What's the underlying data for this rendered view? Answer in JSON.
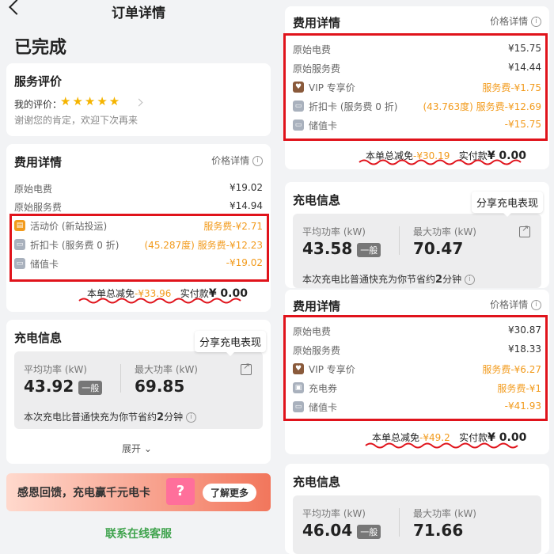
{
  "left": {
    "nav": {
      "title": "订单详情"
    },
    "status": "已完成",
    "review": {
      "title": "服务评价",
      "my_rating_label": "我的评价：",
      "stars": "★★★★★",
      "thanks": "谢谢您的肯定，欢迎下次再来"
    },
    "fees": {
      "title": "费用详情",
      "price_detail": "价格详情",
      "rows": [
        {
          "label": "原始电费",
          "value": "¥19.02"
        },
        {
          "label": "原始服务费",
          "value": "¥14.94"
        }
      ],
      "discounts": [
        {
          "icon": "activity-icon",
          "label": "活动价 (新站投运)",
          "value": "服务费-¥2.71"
        },
        {
          "icon": "card-icon",
          "label": "折扣卡 (服务费 0 折)",
          "value": "(45.287度) 服务费-¥12.23"
        },
        {
          "icon": "card-icon",
          "label": "储值卡",
          "value": "-¥19.02"
        }
      ],
      "total_discount_label": "本单总减免",
      "total_discount_value": "-¥33.96",
      "paid_label": "实付款",
      "paid_value": "¥ 0.00"
    },
    "charge": {
      "title": "充电信息",
      "tooltip": "分享充电表现",
      "avg_label": "平均功率 (kW)",
      "avg_value": "43.92",
      "avg_tag": "一般",
      "max_label": "最大功率 (kW)",
      "max_value": "69.85",
      "note": "本次充电比普通快充为你节省约",
      "note_num": "2",
      "note_unit": "分钟",
      "expand": "展开"
    },
    "banner": {
      "text": "感恩回馈，充电赢千元电卡",
      "button": "了解更多",
      "gift": "?"
    },
    "contact": "联系在线客服"
  },
  "right_top": {
    "fees": {
      "title": "费用详情",
      "price_detail": "价格详情",
      "rows": [
        {
          "label": "原始电费",
          "value": "¥15.75"
        },
        {
          "label": "原始服务费",
          "value": "¥14.44"
        }
      ],
      "discounts": [
        {
          "icon": "vip-icon",
          "label": "VIP 专享价",
          "value": "服务费-¥1.75"
        },
        {
          "icon": "card-icon",
          "label": "折扣卡 (服务费 0 折)",
          "value": "(43.763度) 服务费-¥12.69"
        },
        {
          "icon": "card-icon",
          "label": "储值卡",
          "value": "-¥15.75"
        }
      ],
      "total_discount_label": "本单总减免",
      "total_discount_value": "-¥30.19",
      "paid_label": "实付款",
      "paid_value": "¥ 0.00"
    },
    "charge": {
      "title": "充电信息",
      "tooltip": "分享充电表现",
      "avg_label": "平均功率 (kW)",
      "avg_value": "43.58",
      "avg_tag": "一般",
      "max_label": "最大功率 (kW)",
      "max_value": "70.47",
      "note": "本次充电比普通快充为你节省约",
      "note_num": "2",
      "note_unit": "分钟"
    }
  },
  "right_bottom": {
    "fees": {
      "title": "费用详情",
      "price_detail": "价格详情",
      "rows": [
        {
          "label": "原始电费",
          "value": "¥30.87"
        },
        {
          "label": "原始服务费",
          "value": "¥18.33"
        }
      ],
      "discounts": [
        {
          "icon": "vip-icon",
          "label": "VIP 专享价",
          "value": "服务费-¥6.27"
        },
        {
          "icon": "coupon-icon",
          "label": "充电券",
          "value": "服务费-¥1"
        },
        {
          "icon": "card-icon",
          "label": "储值卡",
          "value": "-¥41.93"
        }
      ],
      "total_discount_label": "本单总减免",
      "total_discount_value": "-¥49.2",
      "paid_label": "实付款",
      "paid_value": "¥ 0.00"
    },
    "charge": {
      "title": "充电信息",
      "avg_label": "平均功率 (kW)",
      "avg_value": "46.04",
      "avg_tag": "一般",
      "max_label": "最大功率 (kW)",
      "max_value": "71.66"
    }
  },
  "colors": {
    "orange": "#f29a1b",
    "red_box": "#e0131b",
    "green": "#3fa34d"
  }
}
